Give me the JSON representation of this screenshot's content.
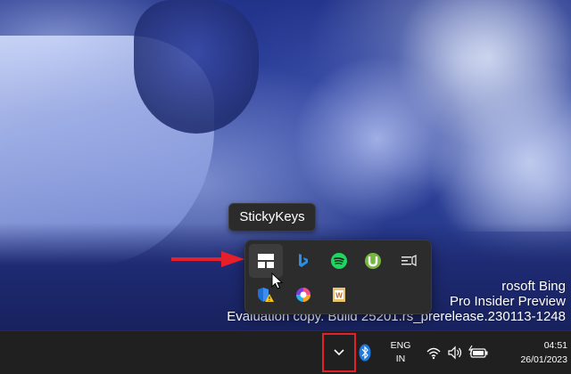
{
  "tooltip": {
    "text": "StickyKeys"
  },
  "watermark": {
    "line1": "rosoft Bing",
    "line2": "Pro Insider Preview",
    "line3": "Evaluation copy. Build 25201.rs_prerelease.230113-1248"
  },
  "tray_overflow": {
    "icons": [
      "stickykeys-icon",
      "bing-icon",
      "spotify-icon",
      "utorrent-icon",
      "screen-cast-icon",
      "security-warning-icon",
      "copilot-icon",
      "office-word-icon"
    ]
  },
  "taskbar": {
    "language": {
      "code": "ENG",
      "region": "IN"
    },
    "clock": {
      "time": "04:51",
      "date": "26/01/2023"
    }
  },
  "colors": {
    "highlight": "#e5202a",
    "taskbar": "#202020",
    "flyout": "#2c2c2c"
  }
}
